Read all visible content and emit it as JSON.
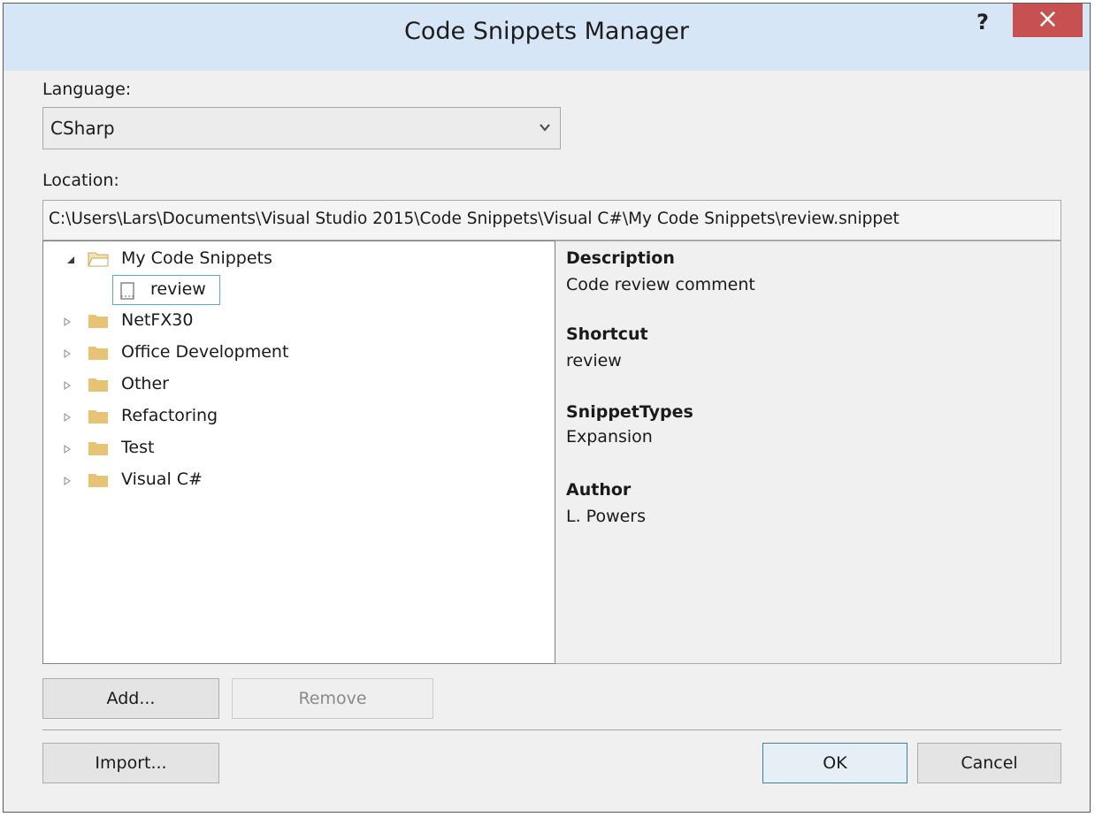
{
  "window": {
    "title": "Code Snippets Manager",
    "help_label": "?",
    "close_label": "×"
  },
  "language": {
    "label": "Language:",
    "selected": "CSharp"
  },
  "location": {
    "label": "Location:",
    "path": "C:\\Users\\Lars\\Documents\\Visual Studio 2015\\Code Snippets\\Visual C#\\My Code Snippets\\review.snippet"
  },
  "tree": {
    "root": {
      "label": "My Code Snippets",
      "expanded": true,
      "children": [
        {
          "label": "review",
          "selected": true
        }
      ]
    },
    "folders": [
      {
        "label": "NetFX30"
      },
      {
        "label": "Office Development"
      },
      {
        "label": "Other"
      },
      {
        "label": "Refactoring"
      },
      {
        "label": "Test"
      },
      {
        "label": "Visual C#"
      }
    ]
  },
  "details": {
    "description_heading": "Description",
    "description_value": "Code review comment",
    "shortcut_heading": "Shortcut",
    "shortcut_value": "review",
    "types_heading": "SnippetTypes",
    "types_value": "Expansion",
    "author_heading": "Author",
    "author_value": "L. Powers"
  },
  "buttons": {
    "add": "Add...",
    "remove": "Remove",
    "import": "Import...",
    "ok": "OK",
    "cancel": "Cancel"
  },
  "colors": {
    "titlebar": "#d6e6f7",
    "close": "#c75050",
    "folder": "#e7c475",
    "selection_border": "#5ea5dc"
  },
  "icons": {
    "expanded_arrow": "triangle-down-right-icon",
    "collapsed_arrow": "triangle-right-outline-icon",
    "folder": "folder-icon",
    "open_folder": "folder-open-icon",
    "file": "snippet-file-icon",
    "dropdown": "chevron-down-icon"
  }
}
